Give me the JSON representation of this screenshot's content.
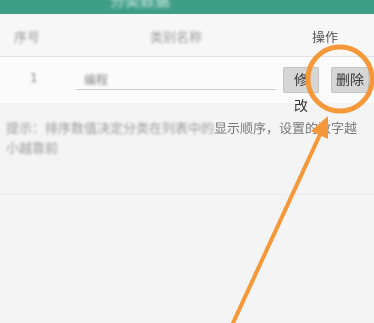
{
  "header": {
    "title": "分类数据"
  },
  "table": {
    "columns": {
      "index": "序号",
      "name": "类别名称",
      "ops": "操作"
    },
    "rows": [
      {
        "index": "1",
        "name": "编程",
        "edit_label": "修改",
        "delete_label": "删除"
      }
    ]
  },
  "hint": {
    "blurred_part": "提示：排序数值决定分类在列表中的",
    "visible_part": "显示顺序，设置的数字越",
    "line2": "小越靠前"
  },
  "colors": {
    "header": "#3f9e86",
    "annotation": "#f5983a"
  },
  "annotation": {
    "shape": "circle-and-arrow",
    "target": "delete-button"
  }
}
